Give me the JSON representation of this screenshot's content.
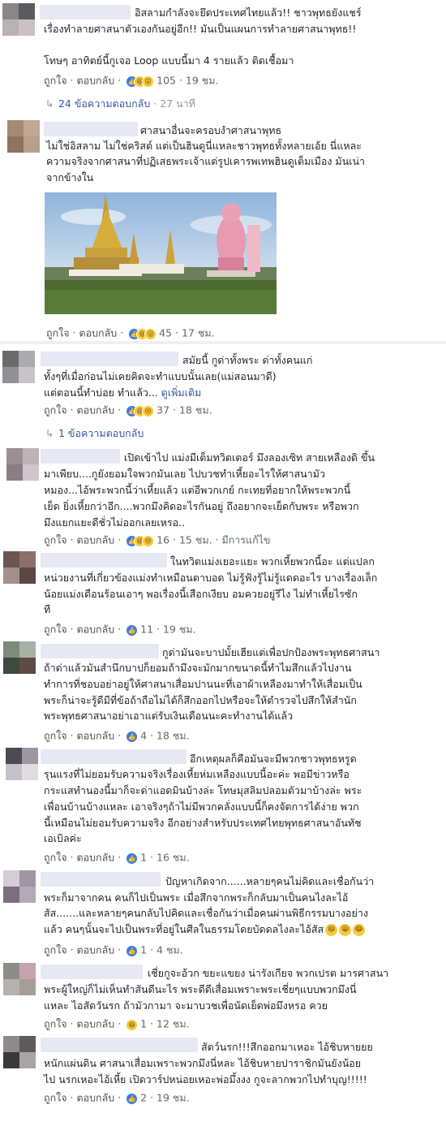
{
  "comments": [
    {
      "lines": [
        "อิสลามกำลังจะยึดประเทศไทยแล้ว!! ชาวพุทธยังแชร์",
        "เรื่องทำลายศาสนาตัวเองกันอยู่อีก!! มันเป็นแผนการทำลายศาสนาพุทธ!!",
        "",
        "โทษๆ อาทิตย์นี้กูเจอ Loop แบบนี้มา 4 รายแล้ว ติดเชื้อมา"
      ],
      "like": "ถูกใจ",
      "reply": "ตอบกลับ",
      "reactions": "105",
      "time": "19 ชม.",
      "replies_text": "24 ข้อความตอบกลับ",
      "replies_time": "27 นาที"
    },
    {
      "lines": [
        "ศาสนาอื่นจะครอบงำศาสนาพุทธ",
        "ไม่ใช่อิสลาม ไม่ใช่คริสต์ แต่เป็นฮินดูนี่แหละชาวพุทธทั้งหลายเอ้ย นี่แหละ",
        "ความจริงจากศาสนาที่ปฏิเสธพระเจ้าแต่รูปเคารพเทพฮินดูเต็มเมือง มันเน่า",
        "จากข้างใน"
      ],
      "like": "ถูกใจ",
      "reply": "ตอบกลับ",
      "reactions": "45",
      "time": "17 ชม."
    },
    {
      "lines": [
        "สมัยนี้ กูด่าทั้งพระ ด่าทั้งคนแก่",
        "ทั้งๆที่เมื่อก่อนไม่เคยคิดจะทำแบบนั้นเลย(แม่สอนมาดี)",
        "แต่ตอนนี้ทำบ่อย ทำแล้ว...",
        "ดูเพิ่มเติม"
      ],
      "like": "ถูกใจ",
      "reply": "ตอบกลับ",
      "reactions": "37",
      "time": "18 ชม.",
      "replies_text": "1 ข้อความตอบกลับ"
    },
    {
      "lines": [
        "เปิดเข้าไป แม่งมีเต็มทวิตเตอร์ มึงลองเซิท สายเหลืองดิ ขึ้น",
        "มาเพียบ....กูยังยอมใจพวกมันเลย ไปบวชทำเหี้ยอะไรให้ศาสนามัว",
        "หมอง...ไอ้พระพวกนี้ว่าเหี้ยแล้ว แต่อีพวกเกย์ กะเทยที่อยากให้พระพวกนี้",
        "เย็ด ยิ่งเหี้ยกว่าอีก....พวกมึงคิดอะไรกันอยู่ ถึงอยากจะเย็ดกับพระ หรือพวก",
        "มึงแยกแยะดีชั่วไม่ออกเลยเหรอ.."
      ],
      "like": "ถูกใจ",
      "reply": "ตอบกลับ",
      "reactions": "16",
      "time": "15 ชม.",
      "edited": "มีการแก้ไข"
    },
    {
      "lines": [
        "ในทวิตแม่งเยอะแยะ พวกเหี้ยพวกนี้อะ แต่แปลก",
        "หน่วยงานที่เกี่ยวข้องแม่งทำเหมือนตาบอด ไม่รู้ฟ้งรู้ไม่รู้แดดอะไร บางเรื่องเล็ก",
        "น้อยแม่งเดือนร้อนเอาๆ พอเรื่องนี้เสือกเงียบ อมควยอยู่รึไง ไม่ทำเหี้ยไรซัก",
        "ที"
      ],
      "like": "ถูกใจ",
      "reply": "ตอบกลับ",
      "reactions": "11",
      "time": "19 ชม."
    },
    {
      "lines": [
        "กูด่ามันจะบาปมั้ยเฮียแต่เพื่อปกป้องพระพุทธศาสนา",
        "ถ้าด่าแล้วมันสำนึกบาปก็ยอมถ้ามึงจะมักมากขนาดนี้ทำไมสึกแล้วไปงาน",
        "ทำการที่ชอบอย่าอยู่ให้ศาสนาเสื่อมปานนะที่เอาผ้าเหลืองมาทำให้เสื่อมเป็น",
        "พระก็น่าจะรู้ดีมีที่ข้อถ้าถือไม่ได้ก็สึกออกไปหรือจะให้ตำรวจไปสึกให้สำนัก",
        "พระพุทธศาสนาอย่าเอาแต่รับเงินเดือนนะคะทำงานได้แล้ว"
      ],
      "like": "ถูกใจ",
      "reply": "ตอบกลับ",
      "reactions": "4",
      "time": "18 ชม."
    },
    {
      "lines": [
        "อีกเหตุผลก็คือมันจะมีพวกชาวพุทธหรูด",
        "รุนแรงที่ไม่ยอมรับความจริงเรื่องเหี้ยห่มเหลืองแบบนี้อะค่ะ พอมีข่าวหรือ",
        "กระแสทำนองนี้มาก็จะด่าแอดมินบ้างล่ะ โทษมุสลิมปลอมตัวมาบ้างล่ะ พระ",
        "เพื่อนบ้านบ้างแหละ เอาจริงๆถ้าไม่มีพวกคลั่งแบบนี้ก็คงจัดการได้ง่าย พวก",
        "นี้เหมือนไม่ยอมรับความจริง อีกอย่างสำหรับประเทศไทยพุทธศาสนาอันทัช",
        "เอเบิลค่ะ"
      ],
      "like": "ถูกใจ",
      "reply": "ตอบกลับ",
      "reactions": "1",
      "time": "16 ชม."
    },
    {
      "lines": [
        "ปัญหาเกิดจาก......หลายๆคนไม่คิดและเชื่อกันว่า",
        "พระก็มาจากคน คนก็ไปเป็นพระ เมื่อสึกจากพระก็กลับมาเป็นคนไงละไอ้",
        "สัส.......และหลายๆคนกลับไปคิดและเชื่อกันว่าเมื่อคนผ่านพิธีกรรมบางอย่าง",
        "แล้ว คนๆนั้นจะไปเป็นพระที่อยู่ในศีลในธรรมโดยบัดดลไงละไอ้สัส"
      ],
      "like": "ถูกใจ",
      "reply": "ตอบกลับ",
      "reactions": "1",
      "time": "4 ชม."
    },
    {
      "lines": [
        "เชี่ยกูจะอ้วก ขยะแขยง น่ารังเกียจ พวกเปรต มารศาสนา",
        "พระผู้ใหญ่ก็ไม่เห็นทำสันดีนะไร พระดีดีเสื่อมเพราะพระเชี่ยๆแบบพวกมึงนี่",
        "แหละ ไอสัดวันรก ถ้ามัวกามา จะมาบวชเพื่อนัดเย็ดพ่อมึงหรอ ควย"
      ],
      "like": "ถูกใจ",
      "reply": "ตอบกลับ",
      "reactions": "1",
      "time": "12 ชม."
    },
    {
      "lines": [
        "สัตว์นรก!!!สึกออกมาเหอะ ไอ้ชิบหายยย",
        "หนักแผ่นดิน ศาสนาเสื่อมเพราะพวกมึงนี่หละ ไอ้ชิบหายปาราชิกมันยังน้อย",
        "ไป นรกเหอะไอ้เหี้ย เปิดวาร์ปหน่อยเหอะพ่อมึ้งงง กูจะลากพวกไปทำบุญ!!!!!"
      ],
      "like": "ถูกใจ",
      "reply": "ตอบกลับ",
      "reactions": "2",
      "time": "19 ชม."
    }
  ]
}
